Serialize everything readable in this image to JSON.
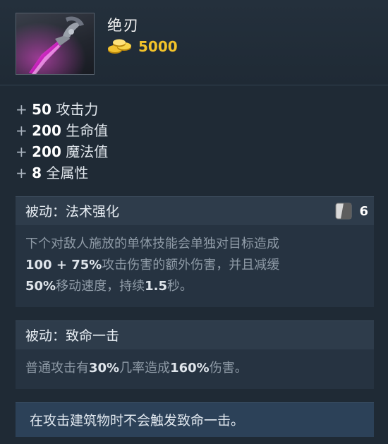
{
  "item": {
    "name": "绝刃",
    "cost": "5000",
    "icon": "blade-icon",
    "gold_icon": "gold-coins-icon"
  },
  "stats": [
    {
      "plus": "+",
      "value": "50",
      "label": "攻击力"
    },
    {
      "plus": "+",
      "value": "200",
      "label": "生命值"
    },
    {
      "plus": "+",
      "value": "200",
      "label": "魔法值"
    },
    {
      "plus": "+",
      "value": "8",
      "label": "全属性"
    }
  ],
  "abilities": [
    {
      "title": "被动：法术强化",
      "cooldown": "6",
      "desc": {
        "l1": "下个对敌人施放的单体技能会单独对目标造成",
        "l2_a": "100 + 75%",
        "l2_b": "攻击伤害的额外伤害，并且减缓",
        "l3_a": "50%",
        "l3_b": "移动速度，持续",
        "l3_c": "1.5",
        "l3_d": "秒。"
      }
    },
    {
      "title": "被动：致命一击",
      "desc": {
        "a": "普通攻击有",
        "b": "30%",
        "c": "几率造成",
        "d": "160%",
        "e": "伤害。"
      }
    }
  ],
  "note": "在攻击建筑物时不会触发致命一击。",
  "colors": {
    "gold": "#f3c32a",
    "background": "#1f2a35",
    "note_background": "#2c4158"
  }
}
